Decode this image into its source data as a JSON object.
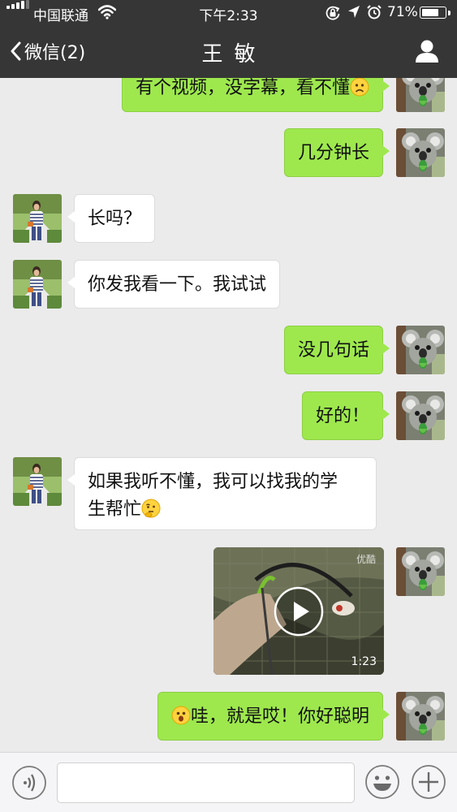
{
  "status_bar": {
    "carrier": "中国联通",
    "time": "下午2:33",
    "battery": "71%",
    "battery_level": 0.71,
    "icons": [
      "signal-icon",
      "wifi-icon",
      "rotation-lock-icon",
      "location-icon",
      "alarm-icon",
      "battery-icon"
    ]
  },
  "nav": {
    "back_label": "微信(2)",
    "title": "王敏",
    "right_icon": "person-icon"
  },
  "messages": [
    {
      "from": "me",
      "type": "text",
      "text": "有个视频，没字幕，看不懂",
      "emoji": "frown-emoji"
    },
    {
      "from": "me",
      "type": "text",
      "text": "几分钟长"
    },
    {
      "from": "other",
      "type": "text",
      "text": "长吗？"
    },
    {
      "from": "other",
      "type": "text",
      "text": "你发我看一下。我试试"
    },
    {
      "from": "me",
      "type": "text",
      "text": "没几句话"
    },
    {
      "from": "me",
      "type": "text",
      "text": "好的！"
    },
    {
      "from": "other",
      "type": "text",
      "lines": [
        "如果我听不懂，我可以找我的学",
        "生帮忙"
      ],
      "emoji": "thinking-emoji"
    },
    {
      "from": "me",
      "type": "video",
      "duration": "1:23",
      "brand": "优酷"
    },
    {
      "from": "me",
      "type": "text",
      "text": "哇，就是哎！你好聪明",
      "emoji_before": "surprised-emoji"
    }
  ],
  "input_bar": {
    "value": "",
    "icons": [
      "voice-icon",
      "emoji-icon",
      "plus-icon"
    ]
  },
  "colors": {
    "header_bg": "#363636",
    "chat_bg": "#ebebeb",
    "my_bubble": "#9ee84e",
    "other_bubble": "#ffffff"
  }
}
